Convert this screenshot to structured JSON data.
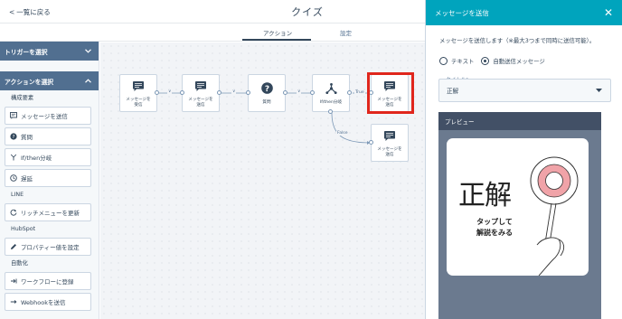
{
  "header": {
    "back_label": "一覧に戻る",
    "title": "クイズ",
    "tabs": [
      {
        "label": "アクション",
        "active": true
      },
      {
        "label": "設定",
        "active": false
      }
    ]
  },
  "sidebar": {
    "trigger_header": "トリガーを選択",
    "action_header": "アクションを選択",
    "sections": [
      {
        "title": "構成要素",
        "items": [
          {
            "label": "メッセージを送信",
            "icon": "message-icon"
          },
          {
            "label": "質問",
            "icon": "question-icon"
          },
          {
            "label": "If/then分岐",
            "icon": "branch-icon"
          },
          {
            "label": "遅延",
            "icon": "clock-icon"
          }
        ]
      },
      {
        "title": "LINE",
        "items": [
          {
            "label": "リッチメニューを更新",
            "icon": "refresh-icon"
          }
        ]
      },
      {
        "title": "HubSpot",
        "items": [
          {
            "label": "プロパティー値を設定",
            "icon": "pencil-icon"
          }
        ]
      },
      {
        "title": "自動化",
        "items": [
          {
            "label": "ワークフローに登録",
            "icon": "workflow-icon"
          },
          {
            "label": "Webhookを送信",
            "icon": "webhook-icon"
          }
        ]
      }
    ]
  },
  "canvas": {
    "nodes": [
      {
        "id": "n1",
        "label_line1": "メッセージを",
        "label_line2": "受信",
        "icon": "message-icon"
      },
      {
        "id": "n2",
        "label_line1": "メッセージを",
        "label_line2": "送信",
        "icon": "message-icon"
      },
      {
        "id": "n3",
        "label_line1": "質問",
        "label_line2": "",
        "icon": "question-icon"
      },
      {
        "id": "n4",
        "label_line1": "If/then分岐",
        "label_line2": "",
        "icon": "branch-icon"
      },
      {
        "id": "n5",
        "label_line1": "メッセージを",
        "label_line2": "送信",
        "icon": "message-icon"
      },
      {
        "id": "n6",
        "label_line1": "メッセージを",
        "label_line2": "送信",
        "icon": "message-icon"
      }
    ],
    "edge_labels": {
      "true_label": "True",
      "false_label": "False"
    }
  },
  "panel": {
    "title": "メッセージを送信",
    "description": "メッセージを送信します（※最大3つまで同時に送信可能）。",
    "radio_options": [
      {
        "label": "テキスト",
        "selected": false
      },
      {
        "label": "自動送信メッセージ",
        "selected": true
      }
    ],
    "title_field_label": "タイトル*",
    "title_field_value": "正解",
    "preview_label": "プレビュー",
    "preview_image": {
      "big_text": "正解",
      "small_text_line1": "タップして",
      "small_text_line2": "解説をみる"
    }
  },
  "colors": {
    "accent": "#00a4bd",
    "sidebar_header": "#516f90",
    "highlight": "#e0261c",
    "preview_bg": "#6b7a8f",
    "maru_ring": "#f0a3a8"
  }
}
